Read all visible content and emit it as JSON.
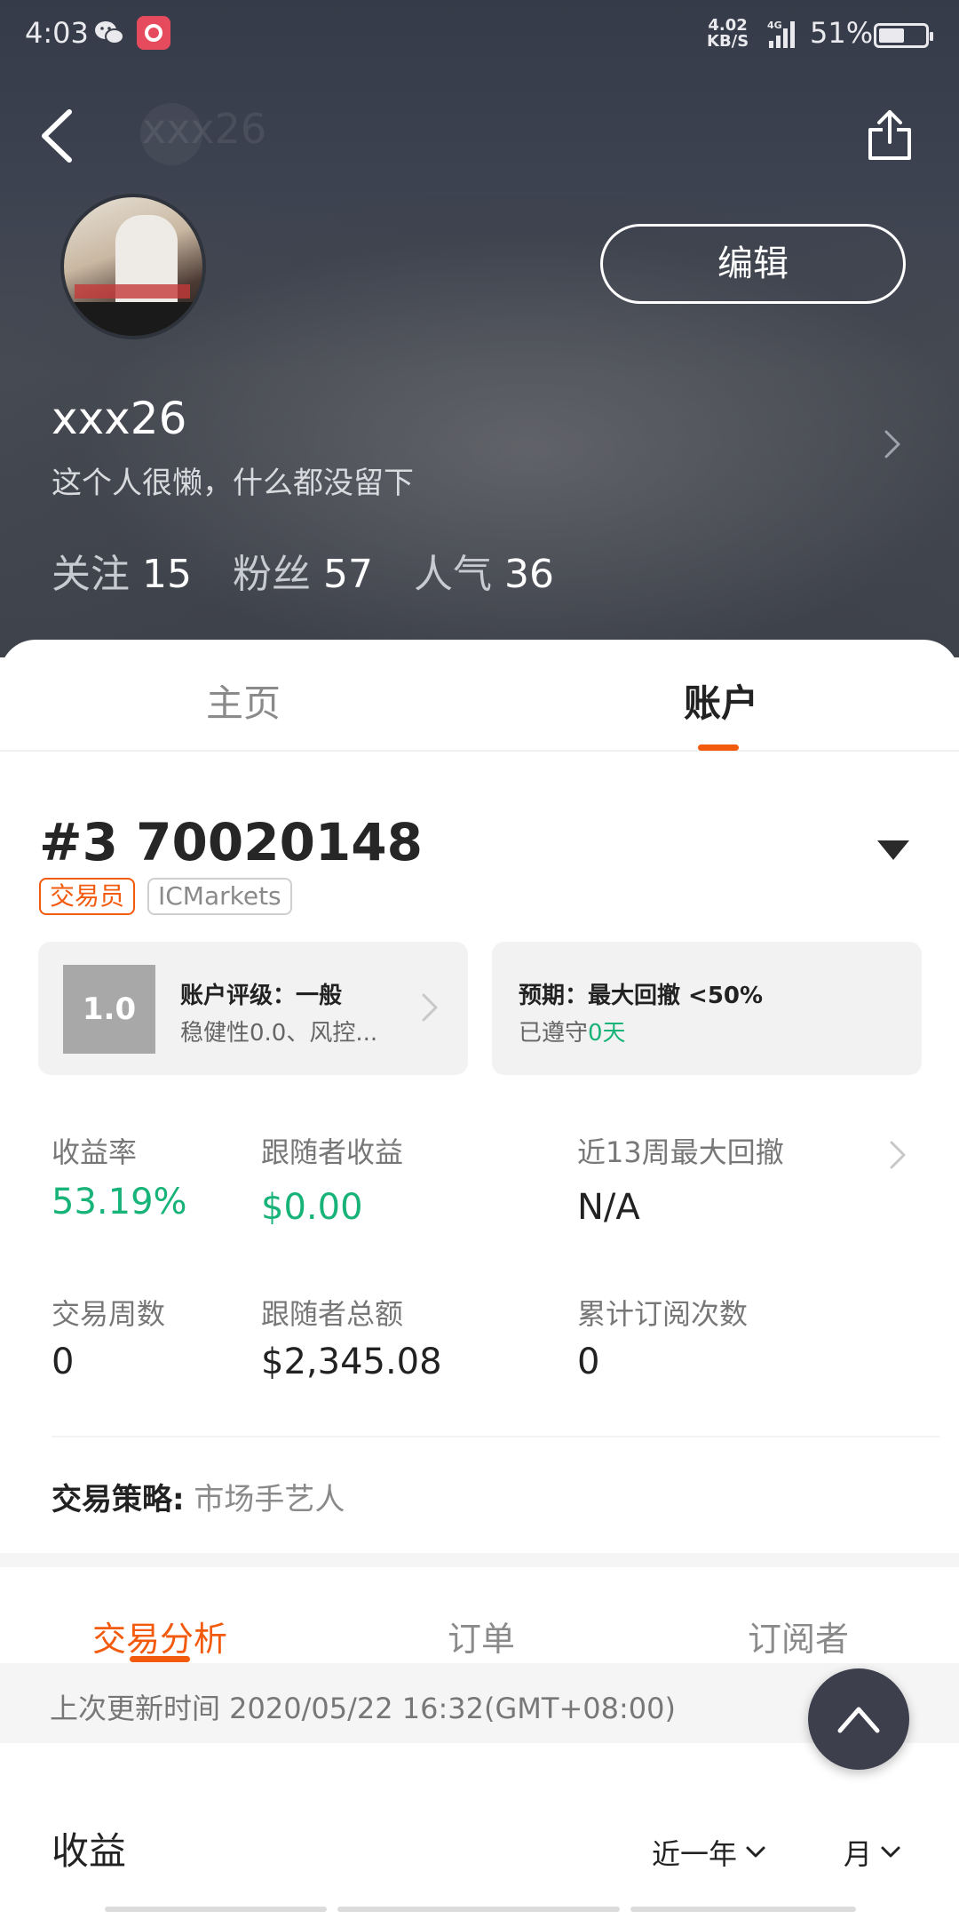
{
  "status_bar": {
    "time": "4:03",
    "net_speed_value": "4.02",
    "net_speed_unit": "KB/S",
    "network": "4G",
    "battery": "51%"
  },
  "profile": {
    "nav_title": "xxx26",
    "edit_label": "编辑",
    "username": "xxx26",
    "bio": "这个人很懒，什么都没留下",
    "stats": [
      {
        "label": "关注",
        "value": "15"
      },
      {
        "label": "粉丝",
        "value": "57"
      },
      {
        "label": "人气",
        "value": "36"
      }
    ]
  },
  "tabs": {
    "home": "主页",
    "account": "账户"
  },
  "account": {
    "id": "#3 70020148",
    "tag_role": "交易员",
    "tag_broker": "ICMarkets",
    "rating_score": "1.0",
    "rating_title": "账户评级：一般",
    "rating_sub": "稳健性0.0、风控...",
    "expect_title": "预期：最大回撤 <50%",
    "expect_sub_prefix": "已遵守",
    "expect_sub_value": "0天"
  },
  "metrics": [
    {
      "label": "收益率",
      "value": "53.19%"
    },
    {
      "label": "跟随者收益",
      "value": "$0.00"
    },
    {
      "label": "近13周最大回撤",
      "value": "N/A"
    },
    {
      "label": "交易周数",
      "value": "0"
    },
    {
      "label": "跟随者总额",
      "value": "$2,345.08"
    },
    {
      "label": "累计订阅次数",
      "value": "0"
    }
  ],
  "strategy": {
    "label": "交易策略:",
    "value": "市场手艺人"
  },
  "sub_tabs": [
    "交易分析",
    "订单",
    "订阅者"
  ],
  "update_text": "上次更新时间 2020/05/22 16:32(GMT+08:00)",
  "income": {
    "title": "收益",
    "period": "近一年",
    "unit": "月"
  },
  "colors": {
    "accent": "#f25a0d",
    "positive": "#17b378",
    "header_bg": "#3c4250"
  }
}
